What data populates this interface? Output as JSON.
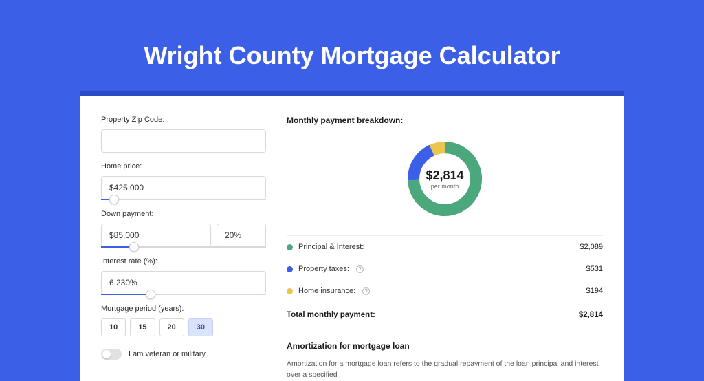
{
  "title": "Wright County Mortgage Calculator",
  "form": {
    "zip_label": "Property Zip Code:",
    "zip_value": "",
    "home_price_label": "Home price:",
    "home_price_value": "$425,000",
    "home_price_slider_pct": 8,
    "down_label": "Down payment:",
    "down_value": "$85,000",
    "down_pct_value": "20%",
    "down_slider_pct": 20,
    "rate_label": "Interest rate (%):",
    "rate_value": "6.230%",
    "rate_slider_pct": 30,
    "period_label": "Mortgage period (years):",
    "periods": [
      "10",
      "15",
      "20",
      "30"
    ],
    "period_selected": "30",
    "veteran_label": "I am veteran or military",
    "veteran_on": false
  },
  "breakdown": {
    "title": "Monthly payment breakdown:",
    "center_amount": "$2,814",
    "center_sub": "per month",
    "items": [
      {
        "label": "Principal & Interest:",
        "value": "$2,089",
        "color": "green",
        "info": false
      },
      {
        "label": "Property taxes:",
        "value": "$531",
        "color": "blue",
        "info": true
      },
      {
        "label": "Home insurance:",
        "value": "$194",
        "color": "yellow",
        "info": true
      }
    ],
    "total_label": "Total monthly payment:",
    "total_value": "$2,814"
  },
  "amortization": {
    "title": "Amortization for mortgage loan",
    "text": "Amortization for a mortgage loan refers to the gradual repayment of the loan principal and interest over a specified"
  },
  "chart_data": {
    "type": "pie",
    "title": "Monthly payment breakdown",
    "series": [
      {
        "name": "Principal & Interest",
        "value": 2089,
        "color": "#4BA77C"
      },
      {
        "name": "Property taxes",
        "value": 531,
        "color": "#3B5FE6"
      },
      {
        "name": "Home insurance",
        "value": 194,
        "color": "#EAC54F"
      }
    ],
    "total": 2814,
    "center_label": "$2,814 per month"
  }
}
